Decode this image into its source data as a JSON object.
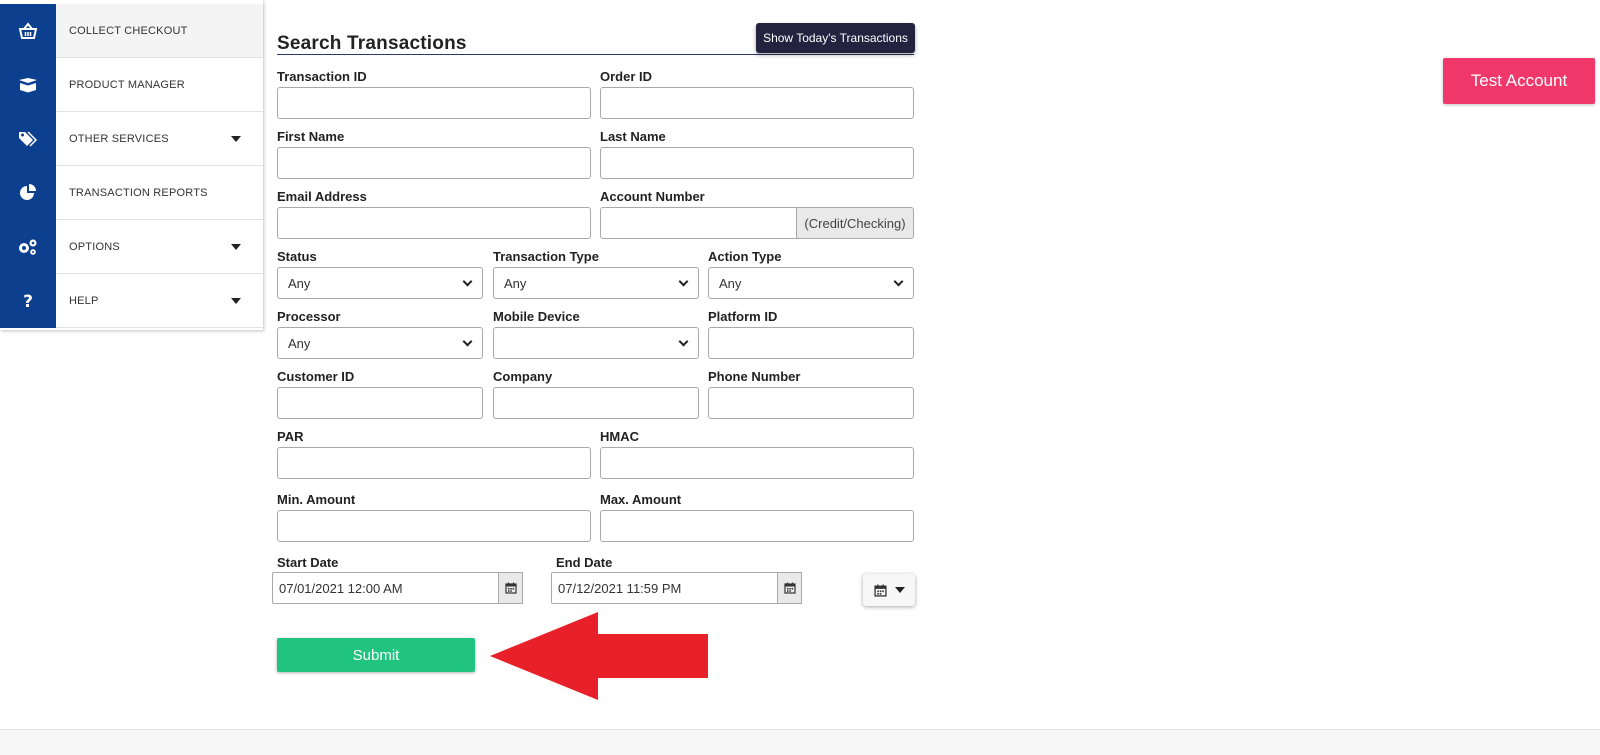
{
  "sidebar": {
    "items": [
      {
        "label": "COLLECT CHECKOUT",
        "icon": "basket-icon",
        "has_dropdown": false
      },
      {
        "label": "PRODUCT MANAGER",
        "icon": "box-icon",
        "has_dropdown": false
      },
      {
        "label": "OTHER SERVICES",
        "icon": "tags-icon",
        "has_dropdown": true
      },
      {
        "label": "TRANSACTION REPORTS",
        "icon": "pie-chart-icon",
        "has_dropdown": false
      },
      {
        "label": "OPTIONS",
        "icon": "gears-icon",
        "has_dropdown": true
      },
      {
        "label": "HELP",
        "icon": "question-icon",
        "has_dropdown": true
      }
    ]
  },
  "header": {
    "title": "Search Transactions",
    "today_button": "Show Today's Transactions",
    "test_account_button": "Test Account"
  },
  "form": {
    "transaction_id": {
      "label": "Transaction ID",
      "value": ""
    },
    "order_id": {
      "label": "Order ID",
      "value": ""
    },
    "first_name": {
      "label": "First Name",
      "value": ""
    },
    "last_name": {
      "label": "Last Name",
      "value": ""
    },
    "email": {
      "label": "Email Address",
      "value": ""
    },
    "account_number": {
      "label": "Account Number",
      "value": "",
      "addon": "(Credit/Checking)"
    },
    "status": {
      "label": "Status",
      "selected": "Any"
    },
    "transaction_type": {
      "label": "Transaction Type",
      "selected": "Any"
    },
    "action_type": {
      "label": "Action Type",
      "selected": "Any"
    },
    "processor": {
      "label": "Processor",
      "selected": "Any"
    },
    "mobile_device": {
      "label": "Mobile Device",
      "selected": ""
    },
    "platform_id": {
      "label": "Platform ID",
      "value": ""
    },
    "customer_id": {
      "label": "Customer ID",
      "value": ""
    },
    "company": {
      "label": "Company",
      "value": ""
    },
    "phone": {
      "label": "Phone Number",
      "value": ""
    },
    "par": {
      "label": "PAR",
      "value": ""
    },
    "hmac": {
      "label": "HMAC",
      "value": ""
    },
    "min_amount": {
      "label": "Min. Amount",
      "value": ""
    },
    "max_amount": {
      "label": "Max. Amount",
      "value": ""
    },
    "start_date": {
      "label": "Start Date",
      "value": "07/01/2021 12:00 AM"
    },
    "end_date": {
      "label": "End Date",
      "value": "07/12/2021 11:59 PM"
    },
    "submit_label": "Submit"
  },
  "colors": {
    "sidebar_icon_bg": "#0d3f8f",
    "today_button_bg": "#232340",
    "test_account_bg": "#f0386b",
    "submit_bg": "#21c47f",
    "arrow_annotation": "#e8202a"
  }
}
